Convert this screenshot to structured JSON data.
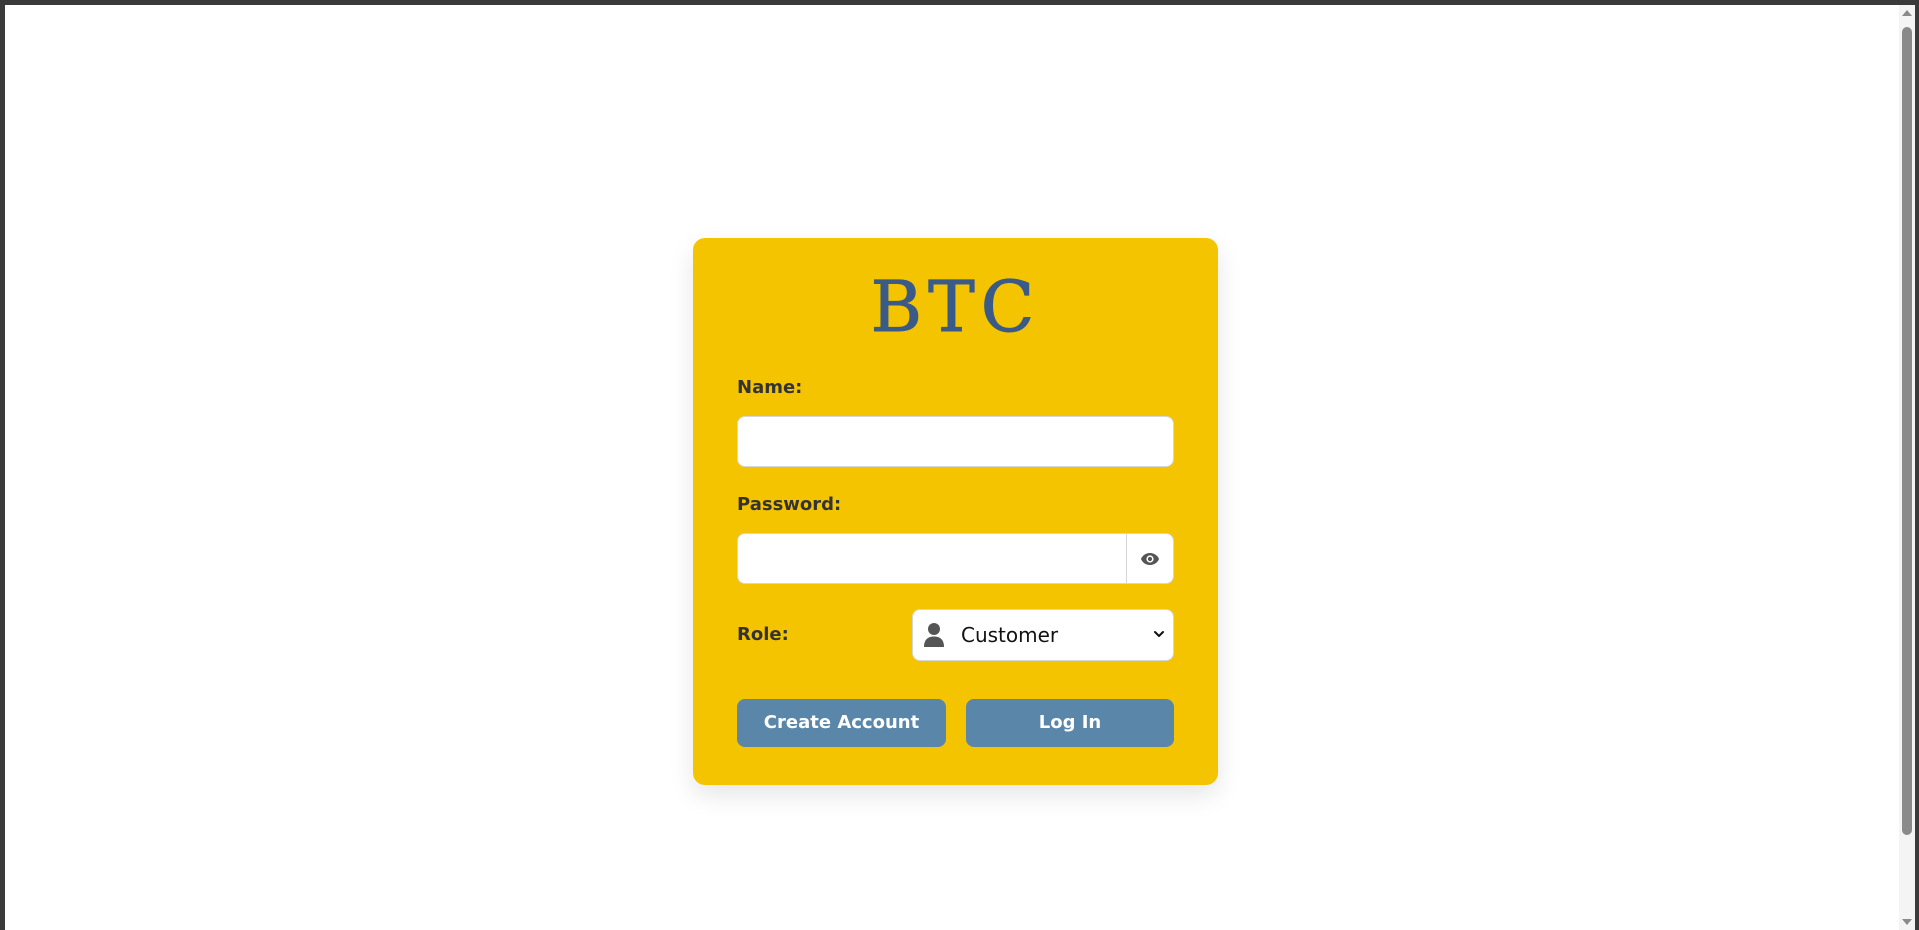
{
  "brand": {
    "logo_text": "BTC",
    "logo_color": "#3a5a88",
    "card_color": "#f5c400",
    "button_color": "#5a86aa"
  },
  "form": {
    "name_label": "Name:",
    "name_value": "",
    "password_label": "Password:",
    "password_value": "",
    "password_toggle_icon": "eye-icon",
    "role_label": "Role:",
    "role_icon": "user-icon",
    "role_selected": "Customer"
  },
  "actions": {
    "create_account_label": "Create Account",
    "login_label": "Log In"
  }
}
